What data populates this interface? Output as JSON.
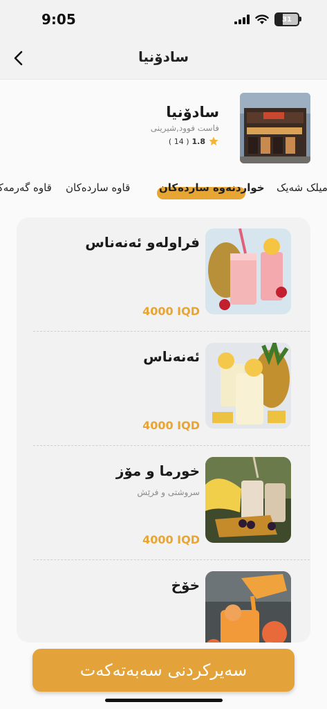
{
  "status_bar": {
    "time": "9:05",
    "battery": "31"
  },
  "nav": {
    "title": "سادۆنیا",
    "back_icon": "chevron-left-icon"
  },
  "restaurant": {
    "name": "سادۆنیا",
    "category": "فاست فوود,شیرینی",
    "rating": "1.8",
    "review_count": "( 14 )"
  },
  "tabs": [
    {
      "label": "قاوە گەرمەکان"
    },
    {
      "label": "قاوە ساردەکان"
    },
    {
      "label": "خواردنەوە ساردەکان",
      "active": true
    },
    {
      "label": "میلک شەیک"
    }
  ],
  "menu": {
    "items": [
      {
        "name": "فراولەو ئەنەناس",
        "desc": "",
        "price": "4000 IQD"
      },
      {
        "name": "ئەنەناس",
        "desc": "",
        "price": "4000 IQD"
      },
      {
        "name": "خورما و مۆز",
        "desc": "سروشتی و فرێش",
        "price": "4000 IQD"
      },
      {
        "name": "خۆخ",
        "desc": "",
        "price": ""
      }
    ]
  },
  "checkout": {
    "label": "سەیرکردنی سەبەتەکەت"
  },
  "colors": {
    "accent": "#e3a33a",
    "price": "#e7a534"
  }
}
